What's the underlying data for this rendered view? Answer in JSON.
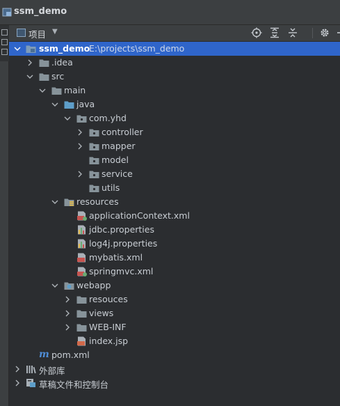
{
  "title": "ssm_demo",
  "panel": {
    "label": "项目",
    "icons": [
      "locate-icon",
      "expand-all-icon",
      "collapse-all-icon",
      "settings-icon",
      "hide-icon"
    ]
  },
  "tree": {
    "root": {
      "label": "ssm_demo",
      "path": "E:\\projects\\ssm_demo"
    },
    "idea": ".idea",
    "src": "src",
    "main": "main",
    "java": "java",
    "pkg": "com.yhd",
    "controller": "controller",
    "mapper": "mapper",
    "model": "model",
    "service": "service",
    "utils": "utils",
    "resources": "resources",
    "appctx": "applicationContext.xml",
    "jdbc": "jdbc.properties",
    "log4j": "log4j.properties",
    "mybatis": "mybatis.xml",
    "springmvc": "springmvc.xml",
    "webapp": "webapp",
    "resouces": "resouces",
    "views": "views",
    "webinf": "WEB-INF",
    "index": "index.jsp",
    "pom": "pom.xml",
    "ext": "外部库",
    "scratch": "草稿文件和控制台"
  },
  "colors": {
    "selection": "#2f65ca",
    "folder": "#87939a",
    "source_folder": "#5e9ec9",
    "resource_folder": "#a5925a"
  }
}
